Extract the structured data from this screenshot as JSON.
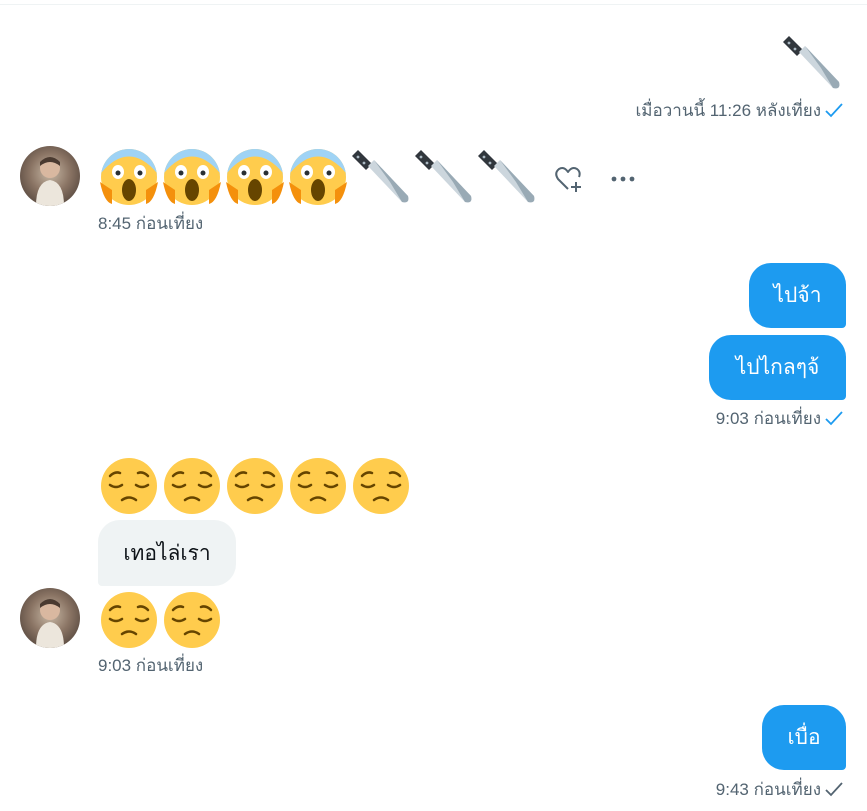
{
  "messages": {
    "m1": {
      "emoji": [
        "knife"
      ],
      "time": "เมื่อวานนี้ 11:26 หลังเที่ยง"
    },
    "m2": {
      "emoji": [
        "face-screaming",
        "face-screaming",
        "face-screaming",
        "face-screaming",
        "knife",
        "knife",
        "knife"
      ],
      "time": "8:45 ก่อนเที่ยง"
    },
    "m3": {
      "text": "ไปจ้า"
    },
    "m4": {
      "text": "ไปไกลๆจ้",
      "time": "9:03 ก่อนเที่ยง"
    },
    "m5": {
      "emoji": [
        "pensive-face",
        "pensive-face",
        "pensive-face",
        "pensive-face",
        "pensive-face"
      ]
    },
    "m6": {
      "text": "เทอไล่เรา"
    },
    "m7": {
      "emoji": [
        "pensive-face",
        "pensive-face"
      ],
      "time": "9:03 ก่อนเที่ยง"
    },
    "m8": {
      "text": "เบื่อ",
      "time": "9:43 ก่อนเที่ยง"
    }
  },
  "colors": {
    "accent": "#1d9bf0",
    "incoming_bubble": "#eff3f4",
    "timestamp": "#536471",
    "check_sent_seen": "#1d9bf0",
    "check_sent": "#536471"
  }
}
